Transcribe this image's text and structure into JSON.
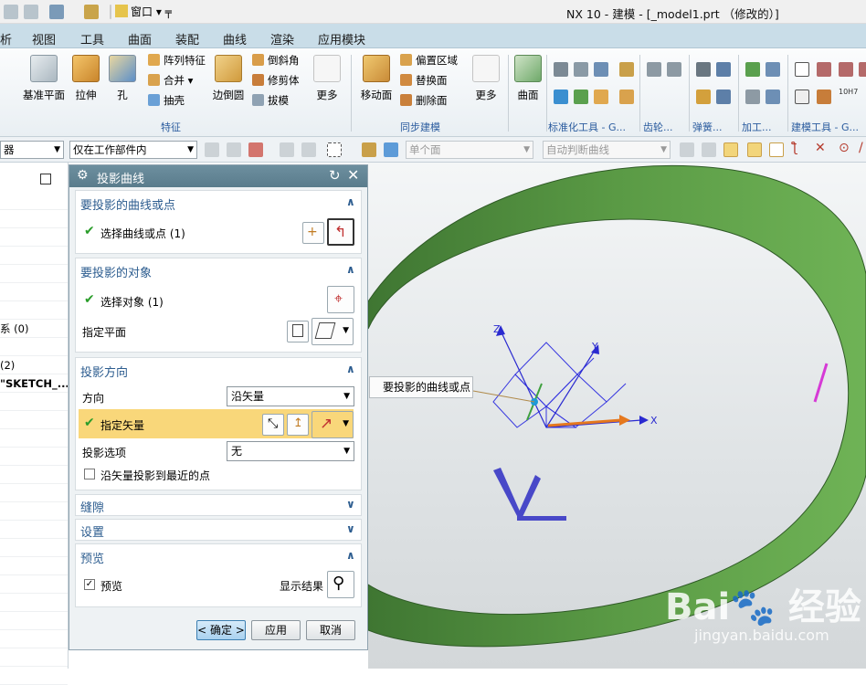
{
  "window": {
    "title": "NX 10 - 建模 - [_model1.prt （修改的）]",
    "window_menu": "窗口 ▾ ╤"
  },
  "menu": [
    "析",
    "视图",
    "工具",
    "曲面",
    "装配",
    "曲线",
    "渲染",
    "应用模块"
  ],
  "ribbon": {
    "datum_plane": "基准平面",
    "extrude": "拉伸",
    "hole": "孔",
    "pattern_feature": "阵列特征",
    "unite": "合并",
    "shell": "抽壳",
    "edge_blend": "边倒圆",
    "chamfer": "倒斜角",
    "trim_body": "修剪体",
    "draft": "拔模",
    "more1": "更多",
    "move_face": "移动面",
    "offset_region": "偏置区域",
    "replace_face": "替换面",
    "delete_face": "删除面",
    "more2": "更多",
    "surface": "曲面",
    "group_feature": "特征",
    "group_sync": "同步建模",
    "group_std": "标准化工具 - G...",
    "group_gear": "齿轮...",
    "group_spring": "弹簧...",
    "group_machining": "加工...",
    "group_modeling_tools": "建模工具 - G...",
    "tolerance_label": "10H7"
  },
  "toolbar2": {
    "filter": "器",
    "scope": "仅在工作部件内",
    "face_rule": "单个面",
    "curve_rule": "自动判断曲线"
  },
  "leftnav": {
    "rows": [
      "",
      "",
      "",
      "",
      "",
      "",
      "",
      "系 (0)",
      "",
      "(2)",
      "\"SKETCH_...",
      "",
      "",
      "",
      "",
      "",
      "",
      "",
      "",
      "",
      "",
      "",
      "",
      "",
      "",
      "",
      ""
    ]
  },
  "dialog": {
    "title": "投影曲线",
    "sec_curves": "要投影的曲线或点",
    "select_curves": "选择曲线或点 (1)",
    "sec_target": "要投影的对象",
    "select_object": "选择对象 (1)",
    "specify_plane": "指定平面",
    "sec_direction": "投影方向",
    "direction_label": "方向",
    "direction_value": "沿矢量",
    "specify_vector": "指定矢量",
    "proj_option_label": "投影选项",
    "proj_option_value": "无",
    "nearest_point": "沿矢量投影到最近的点",
    "nearest_point_checked": false,
    "sec_gap": "缝隙",
    "sec_settings": "设置",
    "sec_preview": "预览",
    "preview_label": "预览",
    "preview_checked": true,
    "show_result": "显示结果",
    "ok": "< 确定 >",
    "apply": "应用",
    "cancel": "取消"
  },
  "viewport": {
    "tooltip": "要投影的曲线或点",
    "axis_x": "X",
    "axis_y": "Y",
    "axis_z": "Z",
    "watermark": "Bai🐾 经验",
    "watermark_url": "jingyan.baidu.com"
  },
  "colors": {
    "ring": "#5a9a45",
    "dialog_header": "#5f8090",
    "highlight_row": "#f9d77a",
    "section_title": "#2c5c8f"
  }
}
